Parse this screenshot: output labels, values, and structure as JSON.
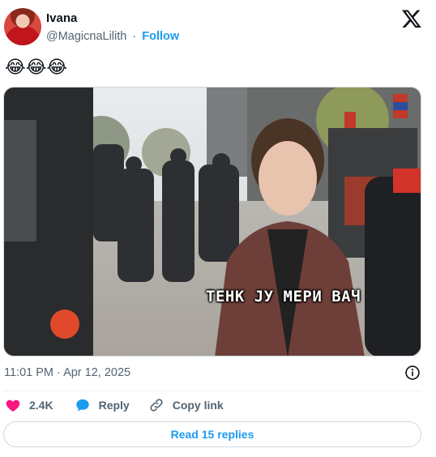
{
  "author": {
    "name": "Ivana",
    "handle": "@MagicnaLilith",
    "separator": "·",
    "follow_label": "Follow",
    "avatar_icon": "profile-photo"
  },
  "brand_icon": "x-logo-icon",
  "tweet": {
    "text": "😂😂😂",
    "image_caption": "ТЕНК ЈУ МЕРИ ВАЧ",
    "timestamp": "11:01 PM · Apr 12, 2025"
  },
  "actions": {
    "like_icon": "heart-icon",
    "like_count": "2.4K",
    "reply_icon": "speech-bubble-icon",
    "reply_label": "Reply",
    "copy_icon": "link-icon",
    "copy_label": "Copy link"
  },
  "read_replies_label": "Read 15 replies",
  "colors": {
    "accent": "#1d9bf0",
    "like": "#f91880",
    "text": "#0f1419",
    "muted": "#536471",
    "border": "#cfd9de"
  }
}
